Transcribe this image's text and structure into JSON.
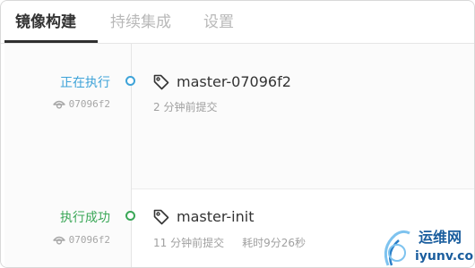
{
  "tabs": [
    {
      "label": "镜像构建",
      "active": true
    },
    {
      "label": "持续集成",
      "active": false
    },
    {
      "label": "设置",
      "active": false
    }
  ],
  "builds": [
    {
      "status": "正在执行",
      "status_color": "#3ea3d8",
      "commit": "07096f2",
      "title": "master-07096f2",
      "time_ago": "2 分钟前提交",
      "duration": ""
    },
    {
      "status": "执行成功",
      "status_color": "#3aa757",
      "commit": "07096f2",
      "title": "master-init",
      "time_ago": "11 分钟前提交",
      "duration": "耗时9分26秒"
    }
  ],
  "watermark": {
    "line1": "运维网",
    "line2": "iyunv.com"
  },
  "icons": {
    "tag": "tag-icon",
    "commit": "commit-icon",
    "timeline_node": "timeline-dot"
  }
}
